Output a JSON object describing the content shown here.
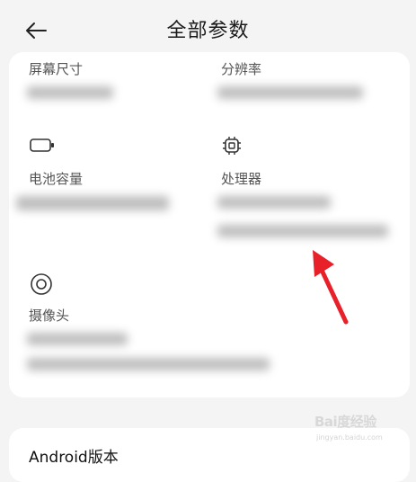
{
  "header": {
    "title": "全部参数",
    "back_icon": "arrow-left-icon"
  },
  "specs": {
    "screen_size": {
      "label": "屏幕尺寸"
    },
    "resolution": {
      "label": "分辨率"
    },
    "battery": {
      "label": "电池容量",
      "icon": "battery-icon"
    },
    "processor": {
      "label": "处理器",
      "icon": "chip-icon"
    },
    "camera": {
      "label": "摄像头",
      "icon": "camera-lens-icon"
    }
  },
  "next_section": {
    "title": "Android版本"
  },
  "watermark": {
    "brand": "Bai度经验",
    "url": "jingyan.baidu.com"
  },
  "annotation": {
    "arrow_color": "#e8202a"
  },
  "colors": {
    "background": "#f4f4f4",
    "card": "#ffffff"
  }
}
